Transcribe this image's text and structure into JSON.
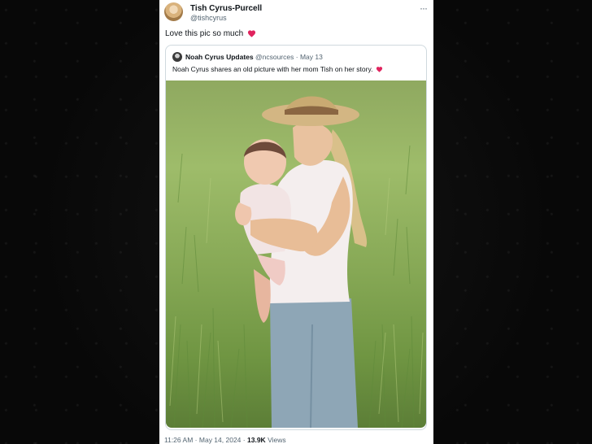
{
  "tweet": {
    "author_name": "Tish Cyrus-Purcell",
    "author_handle": "@tishcyrus",
    "more_icon": "···",
    "text": "Love this pic so much",
    "text_emoji": "red-heart",
    "quoted": {
      "author_name": "Noah Cyrus Updates",
      "author_handle": "@ncsources",
      "separator": "·",
      "date": "May 13",
      "text": "Noah Cyrus shares an old picture with her mom Tish on her story.",
      "text_emoji": "red-heart"
    },
    "footer": {
      "time": "11:26 AM",
      "separator": "·",
      "date": "May 14, 2024",
      "views_count": "13.9K",
      "views_label": "Views"
    }
  },
  "colors": {
    "heart": "#e0245e",
    "muted": "#536471",
    "text": "#0f1419",
    "border": "#cfd9de"
  }
}
